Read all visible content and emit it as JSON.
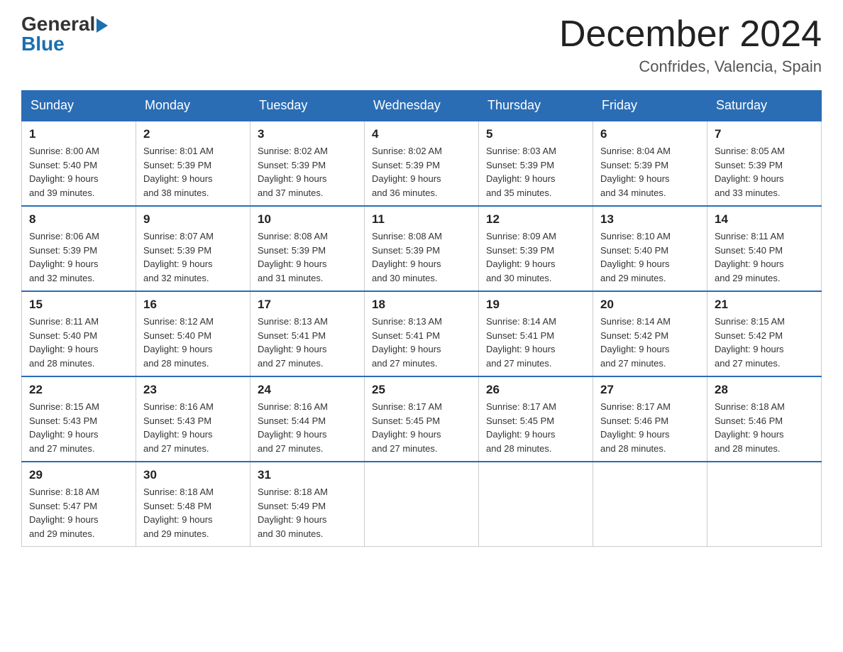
{
  "header": {
    "logo_general": "General",
    "logo_blue": "Blue",
    "month_title": "December 2024",
    "location": "Confrides, Valencia, Spain"
  },
  "days_of_week": [
    "Sunday",
    "Monday",
    "Tuesday",
    "Wednesday",
    "Thursday",
    "Friday",
    "Saturday"
  ],
  "weeks": [
    [
      {
        "day": "1",
        "sunrise": "8:00 AM",
        "sunset": "5:40 PM",
        "daylight": "9 hours and 39 minutes."
      },
      {
        "day": "2",
        "sunrise": "8:01 AM",
        "sunset": "5:39 PM",
        "daylight": "9 hours and 38 minutes."
      },
      {
        "day": "3",
        "sunrise": "8:02 AM",
        "sunset": "5:39 PM",
        "daylight": "9 hours and 37 minutes."
      },
      {
        "day": "4",
        "sunrise": "8:02 AM",
        "sunset": "5:39 PM",
        "daylight": "9 hours and 36 minutes."
      },
      {
        "day": "5",
        "sunrise": "8:03 AM",
        "sunset": "5:39 PM",
        "daylight": "9 hours and 35 minutes."
      },
      {
        "day": "6",
        "sunrise": "8:04 AM",
        "sunset": "5:39 PM",
        "daylight": "9 hours and 34 minutes."
      },
      {
        "day": "7",
        "sunrise": "8:05 AM",
        "sunset": "5:39 PM",
        "daylight": "9 hours and 33 minutes."
      }
    ],
    [
      {
        "day": "8",
        "sunrise": "8:06 AM",
        "sunset": "5:39 PM",
        "daylight": "9 hours and 32 minutes."
      },
      {
        "day": "9",
        "sunrise": "8:07 AM",
        "sunset": "5:39 PM",
        "daylight": "9 hours and 32 minutes."
      },
      {
        "day": "10",
        "sunrise": "8:08 AM",
        "sunset": "5:39 PM",
        "daylight": "9 hours and 31 minutes."
      },
      {
        "day": "11",
        "sunrise": "8:08 AM",
        "sunset": "5:39 PM",
        "daylight": "9 hours and 30 minutes."
      },
      {
        "day": "12",
        "sunrise": "8:09 AM",
        "sunset": "5:39 PM",
        "daylight": "9 hours and 30 minutes."
      },
      {
        "day": "13",
        "sunrise": "8:10 AM",
        "sunset": "5:40 PM",
        "daylight": "9 hours and 29 minutes."
      },
      {
        "day": "14",
        "sunrise": "8:11 AM",
        "sunset": "5:40 PM",
        "daylight": "9 hours and 29 minutes."
      }
    ],
    [
      {
        "day": "15",
        "sunrise": "8:11 AM",
        "sunset": "5:40 PM",
        "daylight": "9 hours and 28 minutes."
      },
      {
        "day": "16",
        "sunrise": "8:12 AM",
        "sunset": "5:40 PM",
        "daylight": "9 hours and 28 minutes."
      },
      {
        "day": "17",
        "sunrise": "8:13 AM",
        "sunset": "5:41 PM",
        "daylight": "9 hours and 27 minutes."
      },
      {
        "day": "18",
        "sunrise": "8:13 AM",
        "sunset": "5:41 PM",
        "daylight": "9 hours and 27 minutes."
      },
      {
        "day": "19",
        "sunrise": "8:14 AM",
        "sunset": "5:41 PM",
        "daylight": "9 hours and 27 minutes."
      },
      {
        "day": "20",
        "sunrise": "8:14 AM",
        "sunset": "5:42 PM",
        "daylight": "9 hours and 27 minutes."
      },
      {
        "day": "21",
        "sunrise": "8:15 AM",
        "sunset": "5:42 PM",
        "daylight": "9 hours and 27 minutes."
      }
    ],
    [
      {
        "day": "22",
        "sunrise": "8:15 AM",
        "sunset": "5:43 PM",
        "daylight": "9 hours and 27 minutes."
      },
      {
        "day": "23",
        "sunrise": "8:16 AM",
        "sunset": "5:43 PM",
        "daylight": "9 hours and 27 minutes."
      },
      {
        "day": "24",
        "sunrise": "8:16 AM",
        "sunset": "5:44 PM",
        "daylight": "9 hours and 27 minutes."
      },
      {
        "day": "25",
        "sunrise": "8:17 AM",
        "sunset": "5:45 PM",
        "daylight": "9 hours and 27 minutes."
      },
      {
        "day": "26",
        "sunrise": "8:17 AM",
        "sunset": "5:45 PM",
        "daylight": "9 hours and 28 minutes."
      },
      {
        "day": "27",
        "sunrise": "8:17 AM",
        "sunset": "5:46 PM",
        "daylight": "9 hours and 28 minutes."
      },
      {
        "day": "28",
        "sunrise": "8:18 AM",
        "sunset": "5:46 PM",
        "daylight": "9 hours and 28 minutes."
      }
    ],
    [
      {
        "day": "29",
        "sunrise": "8:18 AM",
        "sunset": "5:47 PM",
        "daylight": "9 hours and 29 minutes."
      },
      {
        "day": "30",
        "sunrise": "8:18 AM",
        "sunset": "5:48 PM",
        "daylight": "9 hours and 29 minutes."
      },
      {
        "day": "31",
        "sunrise": "8:18 AM",
        "sunset": "5:49 PM",
        "daylight": "9 hours and 30 minutes."
      },
      null,
      null,
      null,
      null
    ]
  ],
  "labels": {
    "sunrise": "Sunrise:",
    "sunset": "Sunset:",
    "daylight": "Daylight:"
  }
}
